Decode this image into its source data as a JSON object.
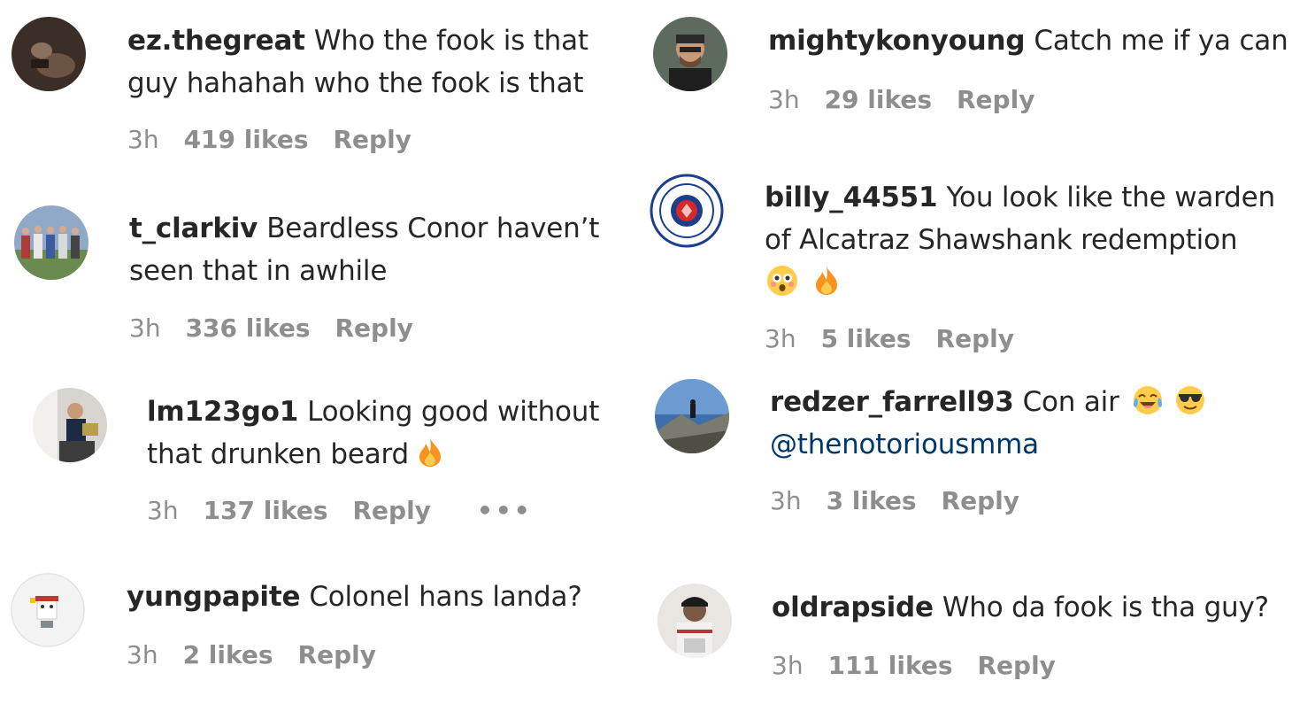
{
  "comments": [
    {
      "username": "ez.thegreat",
      "text": "Who the fook is that guy hahahah who the fook is that",
      "time": "3h",
      "likes": "419 likes",
      "reply": "Reply"
    },
    {
      "username": "t_clarkiv",
      "text": "Beardless Conor haven’t seen that in awhile",
      "time": "3h",
      "likes": "336 likes",
      "reply": "Reply"
    },
    {
      "username": "lm123go1",
      "text": "Looking good without that drunken beard",
      "emoji": [
        "fire-emoji"
      ],
      "time": "3h",
      "likes": "137 likes",
      "reply": "Reply",
      "more": "•••"
    },
    {
      "username": "yungpapite",
      "text": "Colonel hans landa?",
      "time": "3h",
      "likes": "2 likes",
      "reply": "Reply"
    },
    {
      "username": "mightykonyoung",
      "text": "Catch me if ya can",
      "time": "3h",
      "likes": "29 likes",
      "reply": "Reply"
    },
    {
      "username": "billy_44551",
      "text": "You look like the warden of Alcatraz Shawshank redemption",
      "emoji": [
        "flushed-face-emoji",
        "fire-emoji"
      ],
      "time": "3h",
      "likes": "5 likes",
      "reply": "Reply"
    },
    {
      "username": "redzer_farrell93",
      "text": "Con air",
      "emoji": [
        "tears-of-joy-emoji",
        "sunglasses-emoji"
      ],
      "mention": "@thenotoriousmma",
      "time": "3h",
      "likes": "3 likes",
      "reply": "Reply"
    },
    {
      "username": "oldrapside",
      "text": "Who da fook is tha guy?",
      "time": "3h",
      "likes": "111 likes",
      "reply": "Reply"
    }
  ],
  "colors": {
    "text": "#262626",
    "meta": "#8e8e8e",
    "mention": "#00376b",
    "background": "#ffffff"
  }
}
